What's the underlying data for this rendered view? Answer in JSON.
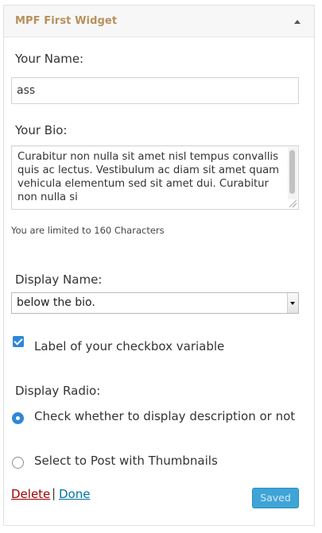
{
  "widget": {
    "title": "MPF First Widget"
  },
  "fields": {
    "name_label": "Your Name:",
    "name_value": "ass",
    "bio_label": "Your Bio:",
    "bio_value": "Curabitur non nulla sit amet nisl tempus convallis quis ac lectus. Vestibulum ac diam sit amet quam vehicula elementum sed sit amet dui. Curabitur non nulla si",
    "bio_hint": "You are limited to 160 Characters",
    "display_name_label": "Display Name:",
    "display_name_selected": "below the bio.",
    "checkbox_label": "Label of your checkbox variable",
    "checkbox_checked": true,
    "radio_group_label": "Display Radio:",
    "radio_options": [
      {
        "label": "Check whether to display description or not",
        "checked": true
      },
      {
        "label": "Select to Post with Thumbnails",
        "checked": false
      }
    ]
  },
  "actions": {
    "delete_label": "Delete",
    "separator": "|",
    "done_label": "Done",
    "saved_label": "Saved"
  },
  "colors": {
    "title": "#b8905a",
    "accent_blue": "#2f87d6",
    "delete_red": "#a00000",
    "link_blue": "#0073aa",
    "saved_button": "#3fa4d6"
  },
  "icons": {
    "collapse": "caret-up-icon",
    "select_arrow": "chevron-down-icon",
    "checkbox": "checkmark-icon",
    "resize": "resize-grip-icon"
  }
}
